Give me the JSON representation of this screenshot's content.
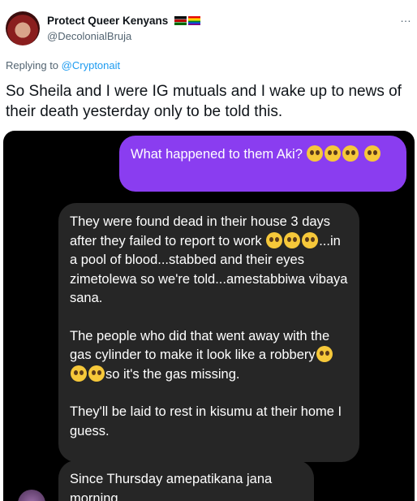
{
  "tweet": {
    "display_name": "Protect Queer Kenyans",
    "handle": "@DecolonialBruja",
    "more_icon": "…",
    "reply_prefix": "Replying to",
    "reply_to": "@Cryptonait",
    "text": "So Sheila and I were IG mutuals and I wake up to news of their death yesterday only to be told this."
  },
  "chat": {
    "outgoing": "What happened to them Aki?",
    "incoming_para1_a": "They were found dead in their house 3 days after they failed to report to work",
    "incoming_para1_b": "...in a pool of blood...stabbed and their eyes zimetolewa so we're told...amestabbiwa vibaya sana.",
    "incoming_para2_a": "The people who did that went away with the gas cylinder to make it look like a robbery",
    "incoming_para2_b": "so it's the gas missing.",
    "incoming_para3": "They'll be laid to rest in kisumu at their home I guess.",
    "incoming2": "Since Thursday amepatikana jana morning"
  },
  "icons": {
    "crying_emoji": "loudly-crying-face",
    "pleading_emoji": "pleading-face"
  }
}
